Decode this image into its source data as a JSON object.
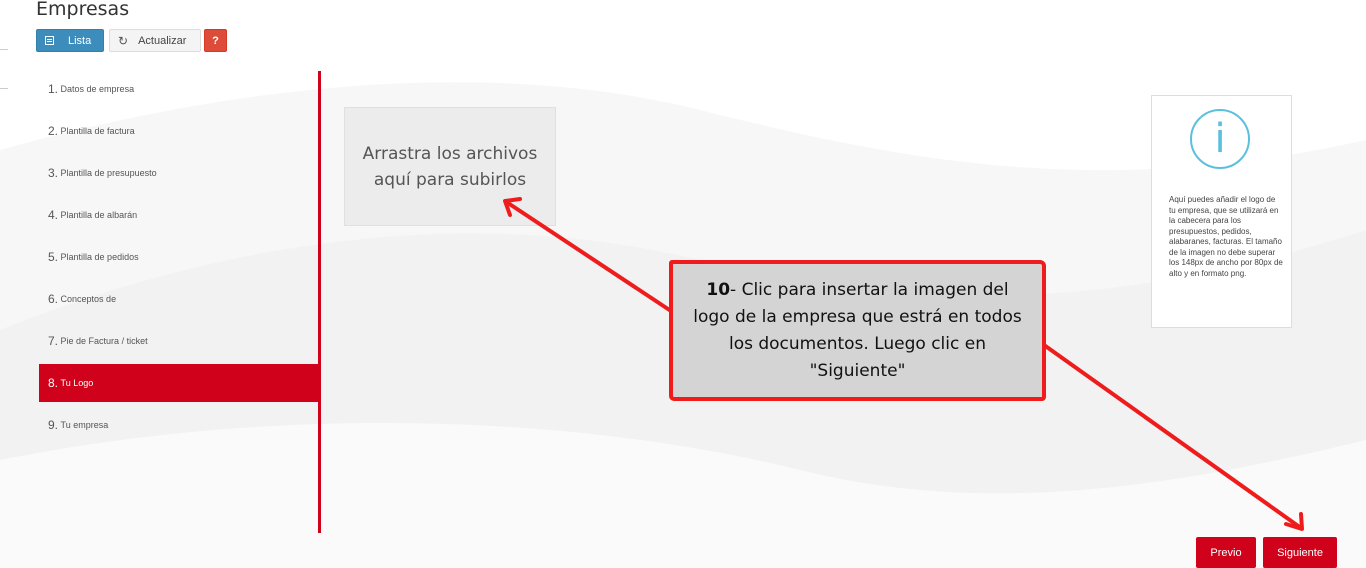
{
  "header": {
    "title": "Empresas"
  },
  "toolbar": {
    "lista_label": "Lista",
    "actualizar_label": "Actualizar",
    "help_label": "?"
  },
  "steps": [
    {
      "num": "1.",
      "label": "Datos de empresa"
    },
    {
      "num": "2.",
      "label": "Plantilla de factura"
    },
    {
      "num": "3.",
      "label": "Plantilla de presupuesto"
    },
    {
      "num": "4.",
      "label": "Plantilla de albarán"
    },
    {
      "num": "5.",
      "label": "Plantilla de pedidos"
    },
    {
      "num": "6.",
      "label": "Conceptos de"
    },
    {
      "num": "7.",
      "label": "Pie de Factura / ticket"
    },
    {
      "num": "8.",
      "label": "Tu Logo"
    },
    {
      "num": "9.",
      "label": "Tu empresa"
    }
  ],
  "active_step": 8,
  "dropzone": {
    "text": "Arrastra los archivos aquí para subirlos"
  },
  "info": {
    "icon": "info-icon",
    "text": "Aquí puedes añadir el logo de tu empresa, que se utilizará en la cabecera para los presupuestos, pedidos, alabaranes, facturas. El tamaño de la imagen no debe superar los 148px de ancho por 80px de alto y en formato png."
  },
  "callout": {
    "number": "10",
    "text": "- Clic para insertar la imagen del logo de la empresa que estrá en todos los documentos. Luego clic en \"Siguiente\""
  },
  "footer": {
    "prev_label": "Previo",
    "next_label": "Siguiente"
  },
  "colors": {
    "accent": "#d0021b",
    "primary": "#3c8dbc",
    "info": "#5bc0de",
    "annotation": "#ee1c1c"
  }
}
